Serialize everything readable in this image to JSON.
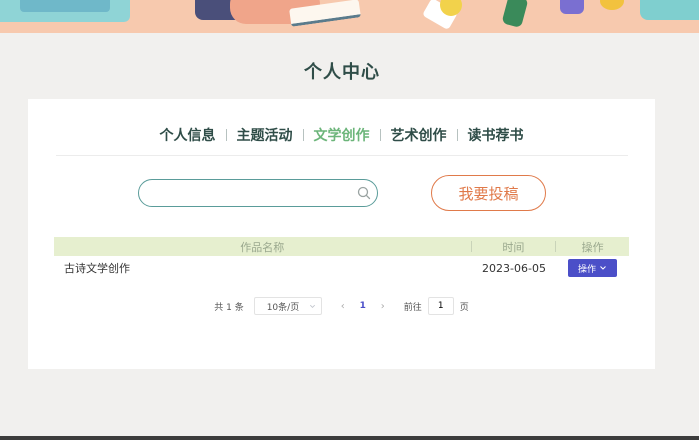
{
  "page": {
    "title": "个人中心"
  },
  "tabs": [
    {
      "label": "个人信息",
      "active": false
    },
    {
      "label": "主题活动",
      "active": false
    },
    {
      "label": "文学创作",
      "active": true
    },
    {
      "label": "艺术创作",
      "active": false
    },
    {
      "label": "读书荐书",
      "active": false
    }
  ],
  "search": {
    "value": "",
    "placeholder": ""
  },
  "submit_button": {
    "label": "我要投稿"
  },
  "table": {
    "columns": [
      "作品名称",
      "时间",
      "操作"
    ],
    "rows": [
      {
        "name": "古诗文学创作",
        "time": "2023-06-05",
        "action": "操作"
      }
    ]
  },
  "pagination": {
    "total": "共 1 条",
    "page_size": "10条/页",
    "current_page": "1",
    "goto_label": "前往",
    "goto_value": "1",
    "page_suffix": "页"
  },
  "colors": {
    "accent_green": "#6cb57a",
    "title_dark": "#2f4d48",
    "submit_orange": "#e07a4a",
    "button_purple": "#4b4fc8",
    "header_bg": "#e6efcf"
  }
}
